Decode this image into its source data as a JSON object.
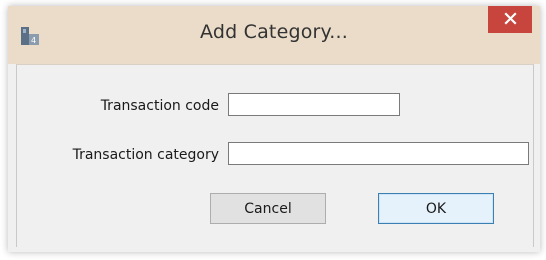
{
  "dialog": {
    "title": "Add Category...",
    "app_icon": "app-icon",
    "close_icon": "close-icon",
    "close_button_color": "#c7453d",
    "titlebar_color": "#eadcc8"
  },
  "form": {
    "code_label": "Transaction code",
    "code_value": "",
    "category_label": "Transaction category",
    "category_value": ""
  },
  "buttons": {
    "cancel_label": "Cancel",
    "ok_label": "OK"
  }
}
